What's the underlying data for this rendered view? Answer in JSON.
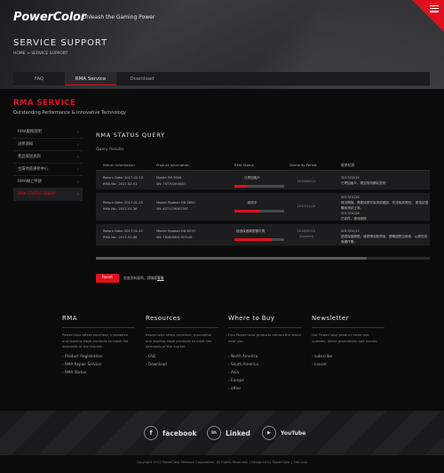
{
  "header": {
    "logo_text": "PowerColor",
    "tagline": "Unleash the Gaming Power",
    "page_title": "SERVICE SUPPORT",
    "breadcrumb": "HOME  >  SERVICE SUPPORT"
  },
  "tabs": [
    {
      "label": "FAQ",
      "active": false
    },
    {
      "label": "RMA Service",
      "active": true
    },
    {
      "label": "Download",
      "active": false
    }
  ],
  "rma": {
    "title": "RMA SERVICE",
    "subtitle": "Outstanding Performance & Innovative Technology"
  },
  "sidebar": {
    "items": [
      {
        "label": "RMA服務說明",
        "active": false
      },
      {
        "label": "送修須知",
        "active": false
      },
      {
        "label": "產品保固查詢",
        "active": false
      },
      {
        "label": "台灣地區維修中心",
        "active": false
      },
      {
        "label": "RMA線上申請",
        "active": false
      },
      {
        "label": "RMA STATUS QUERY",
        "active": true
      }
    ]
  },
  "status": {
    "title": "RMA STATUS QUERY",
    "query_label": "Query Results",
    "columns": [
      "Return Information",
      "Product information",
      "RMA Status",
      "Warranty Period",
      "維修紀錄"
    ],
    "rows": [
      {
        "return_date": "Return Date: 2017-02-15",
        "rma_no": "RMA No.: 2017-02-01",
        "model": "Model: R9 390X",
        "sn": "SN: 7XT-9/2016/07",
        "status_label": "已寄回客戶",
        "progress": 0.25,
        "warranty": "2019/06/15",
        "note_date": "2017/02/15",
        "note": "已寄回客戶，請至物流網站查詢"
      },
      {
        "return_date": "Return Date: 2017-01-25",
        "rma_no": "RMA No.: 2017-01-26",
        "model": "Model: Radeon HD 5850",
        "sn": "SN: 42717/9001767",
        "status_label": "維修中",
        "progress": 0.5,
        "warranty": "2017/11/26",
        "note_date": "2017/01/26",
        "note": "無法開機，需更換零件後測試確認，完成後將寄回。 更換記憶體後測試正常。",
        "note_date2": "2017/01/26",
        "note2": "已收件，等待維修"
      },
      {
        "return_date": "Return Date: 2017-01-12",
        "rma_no": "RMA No.: 2017-01-06",
        "model": "Model: Radeon HD 6570",
        "sn": "SN: 7818/0001707108",
        "status_label": "超過保固期限需付費",
        "progress": 0.75,
        "warranty": "2016/09/15 (Expired)",
        "note_date": "2017/01/12",
        "note": "超過保固期限，維修需收取費用，請確認是否維修，以便安排後續作業。"
      }
    ]
  },
  "reset": {
    "label": "Reset",
    "note_prefix": "若查詢有疑問，請聯繫",
    "note_link": "客服"
  },
  "footer": {
    "columns": [
      {
        "heading": "RMA",
        "text": "PowerColor offers excellent, innovative and leading edge products to meet the demands of the market.",
        "links": [
          "Product Registration",
          "RMA Repair Service",
          "RMA Status"
        ]
      },
      {
        "heading": "Resources",
        "text": "PowerColor offers excellent, innovative and leading edge products to meet the demands of the market.",
        "links": [
          "FAQ",
          "Download"
        ]
      },
      {
        "heading": "Where to Buy",
        "text": "Find PowerColor products around the world near you.",
        "links": [
          "North America",
          "South America",
          "Asia",
          "Europe",
          "other"
        ]
      },
      {
        "heading": "Newsletter",
        "text": "Get PowerColor product news and updates, latest promotions and events.",
        "links": [
          "subscribe",
          "cancel"
        ]
      }
    ]
  },
  "social": [
    {
      "icon": "facebook-icon",
      "glyph": "f",
      "label": "facebook"
    },
    {
      "icon": "linkedin-icon",
      "glyph": "in",
      "label": "Linked"
    },
    {
      "icon": "youtube-icon",
      "glyph": "▶",
      "label": "YouTube"
    }
  ],
  "copyright": "Copyright 2017 PowerColor Network Corporation. All Rights Reserved.  |  Designed by PowerColor  |  Site map",
  "colors": {
    "accent": "#e0101e",
    "background": "#0b0b0c"
  }
}
